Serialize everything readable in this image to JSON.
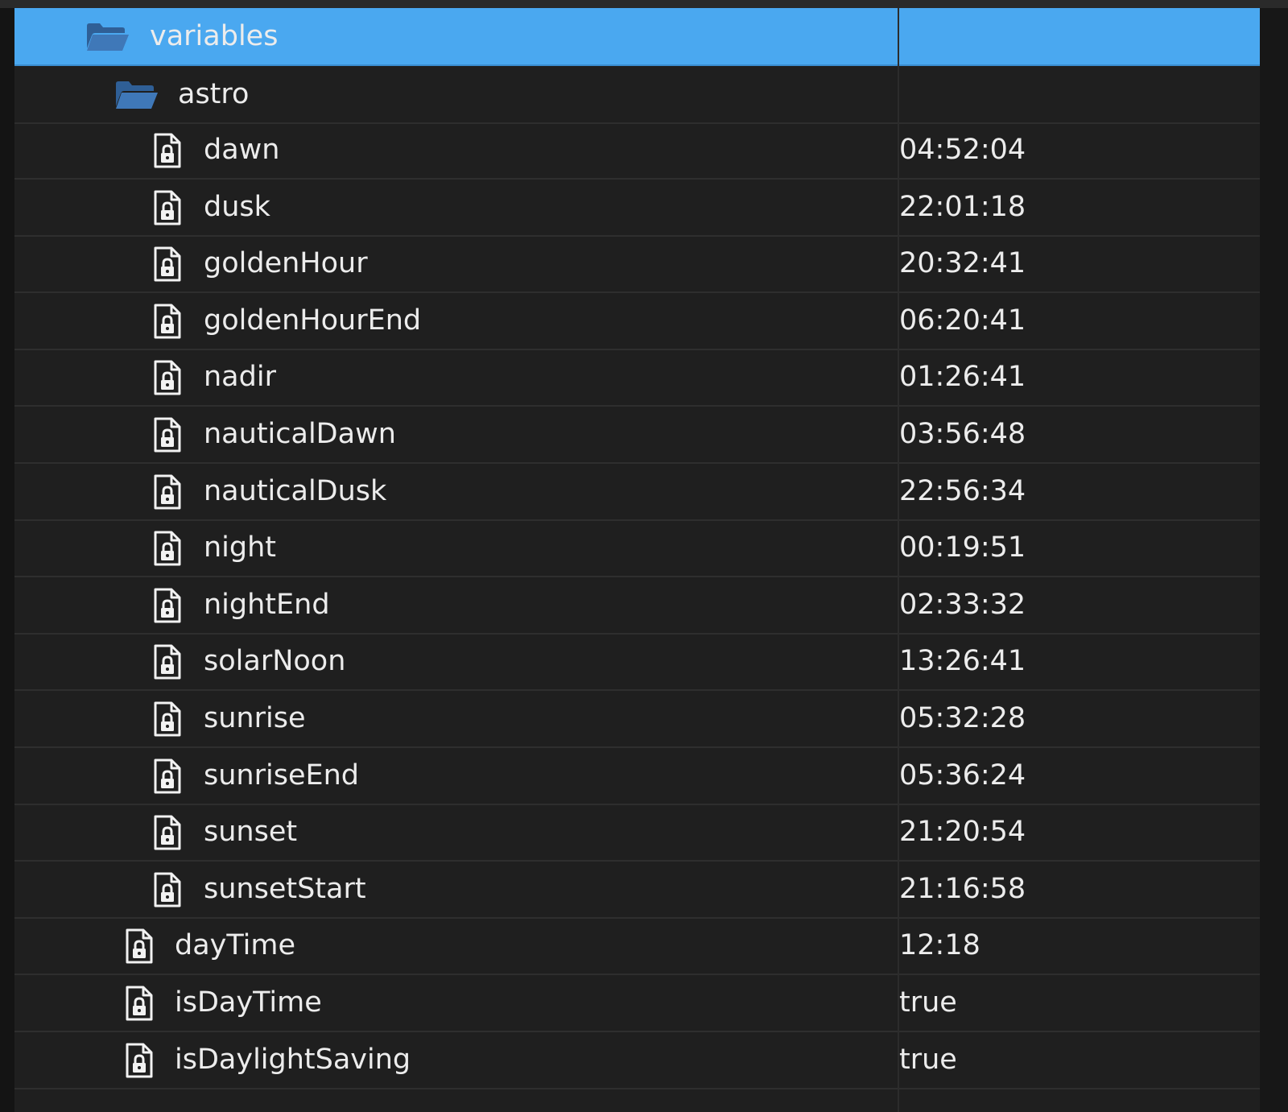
{
  "tree": {
    "root": {
      "label": "variables",
      "icon": "folder-open-icon",
      "selected": true
    },
    "folder": {
      "label": "astro",
      "icon": "folder-open-icon"
    },
    "astro_items": [
      {
        "label": "dawn",
        "value": "04:52:04",
        "icon": "locked-file-icon"
      },
      {
        "label": "dusk",
        "value": "22:01:18",
        "icon": "locked-file-icon"
      },
      {
        "label": "goldenHour",
        "value": "20:32:41",
        "icon": "locked-file-icon"
      },
      {
        "label": "goldenHourEnd",
        "value": "06:20:41",
        "icon": "locked-file-icon"
      },
      {
        "label": "nadir",
        "value": "01:26:41",
        "icon": "locked-file-icon"
      },
      {
        "label": "nauticalDawn",
        "value": "03:56:48",
        "icon": "locked-file-icon"
      },
      {
        "label": "nauticalDusk",
        "value": "22:56:34",
        "icon": "locked-file-icon"
      },
      {
        "label": "night",
        "value": "00:19:51",
        "icon": "locked-file-icon"
      },
      {
        "label": "nightEnd",
        "value": "02:33:32",
        "icon": "locked-file-icon"
      },
      {
        "label": "solarNoon",
        "value": "13:26:41",
        "icon": "locked-file-icon"
      },
      {
        "label": "sunrise",
        "value": "05:32:28",
        "icon": "locked-file-icon"
      },
      {
        "label": "sunriseEnd",
        "value": "05:36:24",
        "icon": "locked-file-icon"
      },
      {
        "label": "sunset",
        "value": "21:20:54",
        "icon": "locked-file-icon"
      },
      {
        "label": "sunsetStart",
        "value": "21:16:58",
        "icon": "locked-file-icon"
      }
    ],
    "variables_items": [
      {
        "label": "dayTime",
        "value": "12:18",
        "icon": "locked-file-icon"
      },
      {
        "label": "isDayTime",
        "value": "true",
        "icon": "locked-file-icon"
      },
      {
        "label": "isDaylightSaving",
        "value": "true",
        "icon": "locked-file-icon"
      }
    ]
  },
  "colors": {
    "selected_row": "#4aa8f0",
    "folder_icon": "#3f78b8",
    "text": "#ececec",
    "background": "#1f1f1f"
  }
}
